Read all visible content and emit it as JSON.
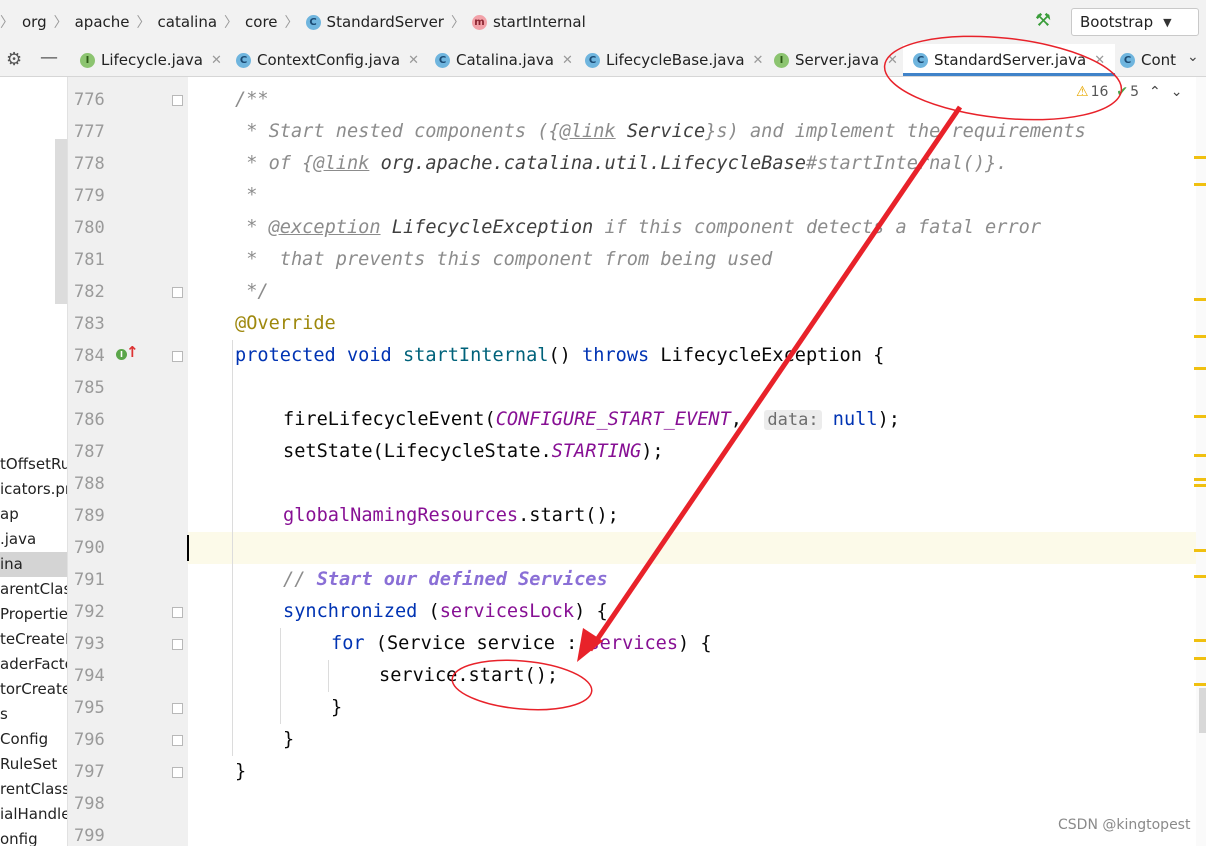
{
  "breadcrumb": [
    {
      "label": "org",
      "icon": ""
    },
    {
      "label": "apache",
      "icon": ""
    },
    {
      "label": "catalina",
      "icon": ""
    },
    {
      "label": "core",
      "icon": ""
    },
    {
      "label": "StandardServer",
      "icon": "class-icon"
    },
    {
      "label": "startInternal",
      "icon": "method-icon"
    }
  ],
  "run_config": {
    "label": "Bootstrap"
  },
  "tabs": [
    {
      "label": "Lifecycle.java",
      "icon": "interface-icon",
      "glyph": "I"
    },
    {
      "label": "ContextConfig.java",
      "icon": "class-icon",
      "glyph": "C"
    },
    {
      "label": "Catalina.java",
      "icon": "class-icon",
      "glyph": "C"
    },
    {
      "label": "LifecycleBase.java",
      "icon": "abstract-class-icon",
      "glyph": "C"
    },
    {
      "label": "Server.java",
      "icon": "interface-icon",
      "glyph": "I"
    },
    {
      "label": "StandardServer.java",
      "icon": "class-icon",
      "glyph": "C",
      "active": true
    },
    {
      "label": "Cont",
      "icon": "class-icon",
      "glyph": "C"
    }
  ],
  "project_tree": [
    "tOffsetRu",
    "icators.pr",
    "ap",
    ".java",
    "ina",
    "arentClass",
    "Propertie",
    "teCreateI",
    "aderFacto",
    "torCreate",
    "s",
    "Config",
    "RuleSet",
    "rentClassL",
    "ialHandle",
    "onfig"
  ],
  "project_tree_selected": "ina",
  "inspections": {
    "warnings": "16",
    "ok": "5"
  },
  "line_numbers": [
    "776",
    "777",
    "778",
    "779",
    "780",
    "781",
    "782",
    "783",
    "784",
    "785",
    "786",
    "787",
    "788",
    "789",
    "790",
    "791",
    "792",
    "793",
    "794",
    "795",
    "796",
    "797",
    "798",
    "799"
  ],
  "code": {
    "l776": "/**",
    "l777_a": " * Start nested components ({",
    "l777_tag": "@link",
    "l777_ref": "Service",
    "l777_b": "}s) and implement the requirements",
    "l778_a": " * of {",
    "l778_tag": "@link",
    "l778_ref": "org.apache.catalina.util.LifecycleBase",
    "l778_b": "#startInternal()}.",
    "l779": " *",
    "l780_a": " * ",
    "l780_tag": "@exception",
    "l780_ref": "LifecycleException",
    "l780_b": " if this component detects a fatal error",
    "l781": " *  that prevents this component from being used",
    "l782": " */",
    "l783": "@Override",
    "l784_kw1": "protected",
    "l784_kw2": "void",
    "l784_fn": "startInternal",
    "l784_a": "() ",
    "l784_kw3": "throws",
    "l784_b": " LifecycleException {",
    "l786_a": "fireLifecycleEvent(",
    "l786_const": "CONFIGURE_START_EVENT",
    "l786_b": ",  ",
    "l786_hint": "data:",
    "l786_null": "null",
    "l786_c": ");",
    "l787_a": "setState(LifecycleState.",
    "l787_const": "STARTING",
    "l787_b": ");",
    "l789_field": "globalNamingResources",
    "l789_b": ".start();",
    "l791_a": "// ",
    "l791_todo": "Start our defined Services",
    "l792_kw": "synchronized",
    "l792_a": " (",
    "l792_field": "servicesLock",
    "l792_b": ") {",
    "l793_kw": "for",
    "l793_a": " (Service service : ",
    "l793_field": "services",
    "l793_b": ") {",
    "l794": "service.start();",
    "l795": "}",
    "l796": "}",
    "l797": "}"
  },
  "watermark": "CSDN @kingtopest",
  "colors": {
    "annotation_red": "#e8222a",
    "active_tab_underline": "#4083c9",
    "current_line": "#fcfae9"
  }
}
